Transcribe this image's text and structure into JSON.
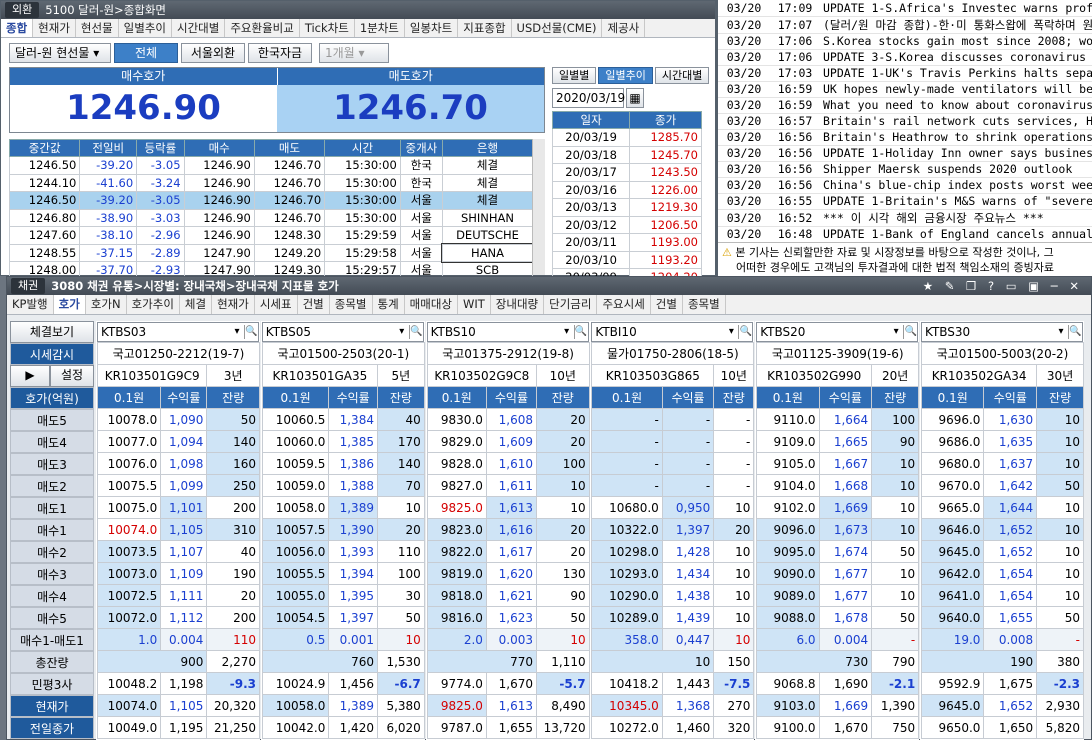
{
  "top_window": {
    "tag": "외환",
    "title": "5100 달러-원>종합화면",
    "tabs": [
      "종합",
      "현재가",
      "현선물",
      "일별추이",
      "시간대별",
      "주요환율비교",
      "Tick차트",
      "1분차트",
      "일봉차트",
      "지표종합",
      "USD선물(CME)",
      "제공사"
    ],
    "currency_select": "달러-원 현선물",
    "filters": [
      "전체",
      "서울외환",
      "한국자금"
    ],
    "period": "1개월",
    "bid_label": "매수호가",
    "ask_label": "매도호가",
    "bid": "1246.90",
    "ask": "1246.70",
    "columns": [
      "중간값",
      "전일비",
      "등락률",
      "매수",
      "매도",
      "시간",
      "중개사",
      "은행"
    ],
    "rows": [
      [
        "1246.50",
        "-39.20",
        "-3.05",
        "1246.90",
        "1246.70",
        "15:30:00",
        "한국",
        "체결"
      ],
      [
        "1244.10",
        "-41.60",
        "-3.24",
        "1246.90",
        "1246.70",
        "15:30:00",
        "한국",
        "체결"
      ],
      [
        "1246.50",
        "-39.20",
        "-3.05",
        "1246.90",
        "1246.70",
        "15:30:00",
        "서울",
        "체결"
      ],
      [
        "1246.80",
        "-38.90",
        "-3.03",
        "1246.90",
        "1246.70",
        "15:30:00",
        "서울",
        "SHINHAN"
      ],
      [
        "1247.60",
        "-38.10",
        "-2.96",
        "1246.90",
        "1248.30",
        "15:29:59",
        "서울",
        "DEUTSCHE"
      ],
      [
        "1248.55",
        "-37.15",
        "-2.89",
        "1247.90",
        "1249.20",
        "15:29:58",
        "서울",
        "HANA"
      ],
      [
        "1248.00",
        "-37.70",
        "-2.93",
        "1247.90",
        "1249.30",
        "15:29:57",
        "서울",
        "SCB"
      ]
    ],
    "daily_tabs": [
      "일별별",
      "일별추이",
      "시간대별"
    ],
    "date": "2020/03/19",
    "daily_cols": [
      "일자",
      "종가"
    ],
    "daily": [
      [
        "20/03/19",
        "1285.70"
      ],
      [
        "20/03/18",
        "1245.70"
      ],
      [
        "20/03/17",
        "1243.50"
      ],
      [
        "20/03/16",
        "1226.00"
      ],
      [
        "20/03/13",
        "1219.30"
      ],
      [
        "20/03/12",
        "1206.50"
      ],
      [
        "20/03/11",
        "1193.00"
      ],
      [
        "20/03/10",
        "1193.20"
      ],
      [
        "20/03/09",
        "1204.20"
      ]
    ]
  },
  "news": {
    "items": [
      [
        "03/20",
        "17:09",
        "UPDATE 1-S.Africa's Investec warns profits c"
      ],
      [
        "03/20",
        "17:07",
        "(달러/원 마감 종합)-한·미 통화스왑에 폭락하며 원"
      ],
      [
        "03/20",
        "17:06",
        "S.Korea stocks gain most since 2008; won su"
      ],
      [
        "03/20",
        "17:06",
        "UPDATE 3-S.Korea discusses coronavirus wi"
      ],
      [
        "03/20",
        "17:03",
        "UPDATE 1-UK's Travis Perkins halts separati"
      ],
      [
        "03/20",
        "16:59",
        "UK hopes newly-made ventilators will be rea"
      ],
      [
        "03/20",
        "16:59",
        "What you need to know about coronavirus ri"
      ],
      [
        "03/20",
        "16:57",
        "Britain's rail network cuts services, Heathrow"
      ],
      [
        "03/20",
        "16:56",
        "Britain's Heathrow to shrink operations during"
      ],
      [
        "03/20",
        "16:56",
        "UPDATE 1-Holiday Inn owner says business"
      ],
      [
        "03/20",
        "16:56",
        "Shipper Maersk suspends 2020 outlook"
      ],
      [
        "03/20",
        "16:56",
        "China's blue-chip index posts worst week in"
      ],
      [
        "03/20",
        "16:55",
        "UPDATE 1-Britain's M&S warns of \"severe imp"
      ],
      [
        "03/20",
        "16:52",
        "*** 이 시각 해외 금융시장 주요뉴스 ***"
      ],
      [
        "03/20",
        "16:48",
        "UPDATE 1-Bank of England cancels annual s"
      ]
    ],
    "disclaimer": "본 기사는 신뢰할만한 자료 및 시장정보를 바탕으로 작성한 것이나, 그",
    "disclaimer2": "어떠한 경우에도 고객님의 투자결과에 대한 법적 책임소재의 증빙자료"
  },
  "bond_window": {
    "tag": "채권",
    "title": "3080 채권 유통>시장별: 장내국채>장내국채 지표물 호가",
    "tabs": [
      "KP발행",
      "호가",
      "호가N",
      "호가추이",
      "체결",
      "현재가",
      "시세표",
      "건별",
      "종목별",
      "통계",
      "매매대상",
      "WIT",
      "장내대량",
      "단기금리",
      "주요시세",
      "건별",
      "종목별"
    ],
    "btn_fill": "체결보기",
    "btn_monitor": "시세감시",
    "btn_set": "설정",
    "hdr_label": "호가(억원)",
    "row_labels": [
      "매도5",
      "매도4",
      "매도3",
      "매도2",
      "매도1",
      "매수1",
      "매수2",
      "매수3",
      "매수4",
      "매수5",
      "매수1-매도1",
      "총잔량",
      "민평3사",
      "현재가",
      "전일종가"
    ],
    "col_headers": [
      "0.1원",
      "수익률",
      "잔량"
    ],
    "panels": [
      {
        "code": "KTBS03",
        "name": "국고01250-2212(19-7)",
        "isin": "KR103501G9C9",
        "term": "3년",
        "rows": [
          [
            "10078.0",
            "1,090",
            "50"
          ],
          [
            "10077.0",
            "1,094",
            "140"
          ],
          [
            "10076.0",
            "1,098",
            "160"
          ],
          [
            "10075.5",
            "1,099",
            "250"
          ],
          [
            "10075.0",
            "1,101",
            "200"
          ],
          [
            "10074.0",
            "1,105",
            "310"
          ],
          [
            "10073.5",
            "1,107",
            "40"
          ],
          [
            "10073.0",
            "1,109",
            "190"
          ],
          [
            "10072.5",
            "1,111",
            "20"
          ],
          [
            "10072.0",
            "1,112",
            "200"
          ],
          [
            "1.0",
            "0.004",
            "110"
          ]
        ],
        "total": [
          "900",
          "2,270"
        ],
        "min": [
          "10048.2",
          "1,198",
          "-9.3"
        ],
        "cur": [
          "10074.0",
          "1,105",
          "20,320"
        ],
        "prev": [
          "10049.0",
          "1,195",
          "21,250"
        ]
      },
      {
        "code": "KTBS05",
        "name": "국고01500-2503(20-1)",
        "isin": "KR103501GA35",
        "term": "5년",
        "rows": [
          [
            "10060.5",
            "1,384",
            "40"
          ],
          [
            "10060.0",
            "1,385",
            "170"
          ],
          [
            "10059.5",
            "1,386",
            "140"
          ],
          [
            "10059.0",
            "1,388",
            "70"
          ],
          [
            "10058.0",
            "1,389",
            "10"
          ],
          [
            "10057.5",
            "1,390",
            "20"
          ],
          [
            "10056.0",
            "1,393",
            "110"
          ],
          [
            "10055.5",
            "1,394",
            "100"
          ],
          [
            "10055.0",
            "1,395",
            "30"
          ],
          [
            "10054.5",
            "1,397",
            "50"
          ],
          [
            "0.5",
            "0.001",
            "10"
          ]
        ],
        "total": [
          "760",
          "1,530"
        ],
        "min": [
          "10024.9",
          "1,456",
          "-6.7"
        ],
        "cur": [
          "10058.0",
          "1,389",
          "5,380"
        ],
        "prev": [
          "10042.0",
          "1,420",
          "6,020"
        ]
      },
      {
        "code": "KTBS10",
        "name": "국고01375-2912(19-8)",
        "isin": "KR103502G9C8",
        "term": "10년",
        "rows": [
          [
            "9830.0",
            "1,608",
            "20"
          ],
          [
            "9829.0",
            "1,609",
            "20"
          ],
          [
            "9828.0",
            "1,610",
            "100"
          ],
          [
            "9827.0",
            "1,611",
            "10"
          ],
          [
            "9825.0",
            "1,613",
            "10"
          ],
          [
            "9823.0",
            "1,616",
            "20"
          ],
          [
            "9822.0",
            "1,617",
            "20"
          ],
          [
            "9819.0",
            "1,620",
            "130"
          ],
          [
            "9818.0",
            "1,621",
            "90"
          ],
          [
            "9816.0",
            "1,623",
            "50"
          ],
          [
            "2.0",
            "0.003",
            "10"
          ]
        ],
        "total": [
          "770",
          "1,110"
        ],
        "min": [
          "9774.0",
          "1,670",
          "-5.7"
        ],
        "cur": [
          "9825.0",
          "1,613",
          "8,490"
        ],
        "prev": [
          "9787.0",
          "1,655",
          "13,720"
        ]
      },
      {
        "code": "KTBI10",
        "name": "물가01750-2806(18-5)",
        "isin": "KR103503G865",
        "term": "10년",
        "rows": [
          [
            "-",
            "-",
            "-"
          ],
          [
            "-",
            "-",
            "-"
          ],
          [
            "-",
            "-",
            "-"
          ],
          [
            "-",
            "-",
            "-"
          ],
          [
            "10680.0",
            "0,950",
            "10"
          ],
          [
            "10322.0",
            "1,397",
            "20"
          ],
          [
            "10298.0",
            "1,428",
            "10"
          ],
          [
            "10293.0",
            "1,434",
            "10"
          ],
          [
            "10290.0",
            "1,438",
            "10"
          ],
          [
            "10289.0",
            "1,439",
            "10"
          ],
          [
            "358.0",
            "0,447",
            "10"
          ]
        ],
        "total": [
          "10",
          "150"
        ],
        "min": [
          "10418.2",
          "1,443",
          "-7.5"
        ],
        "cur": [
          "10345.0",
          "1,368",
          "270"
        ],
        "prev": [
          "10272.0",
          "1,460",
          "320"
        ]
      },
      {
        "code": "KTBS20",
        "name": "국고01125-3909(19-6)",
        "isin": "KR103502G990",
        "term": "20년",
        "rows": [
          [
            "9110.0",
            "1,664",
            "100"
          ],
          [
            "9109.0",
            "1,665",
            "90"
          ],
          [
            "9105.0",
            "1,667",
            "10"
          ],
          [
            "9104.0",
            "1,668",
            "10"
          ],
          [
            "9102.0",
            "1,669",
            "10"
          ],
          [
            "9096.0",
            "1,673",
            "10"
          ],
          [
            "9095.0",
            "1,674",
            "50"
          ],
          [
            "9090.0",
            "1,677",
            "10"
          ],
          [
            "9089.0",
            "1,677",
            "10"
          ],
          [
            "9088.0",
            "1,678",
            "50"
          ],
          [
            "6.0",
            "0.004",
            "-"
          ]
        ],
        "total": [
          "730",
          "790"
        ],
        "min": [
          "9068.8",
          "1,690",
          "-2.1"
        ],
        "cur": [
          "9103.0",
          "1,669",
          "1,390"
        ],
        "prev": [
          "9100.0",
          "1,670",
          "750"
        ]
      },
      {
        "code": "KTBS30",
        "name": "국고01500-5003(20-2)",
        "isin": "KR103502GA34",
        "term": "30년",
        "rows": [
          [
            "9696.0",
            "1,630",
            "10"
          ],
          [
            "9686.0",
            "1,635",
            "10"
          ],
          [
            "9680.0",
            "1,637",
            "10"
          ],
          [
            "9670.0",
            "1,642",
            "50"
          ],
          [
            "9665.0",
            "1,644",
            "10"
          ],
          [
            "9646.0",
            "1,652",
            "10"
          ],
          [
            "9645.0",
            "1,652",
            "10"
          ],
          [
            "9642.0",
            "1,654",
            "10"
          ],
          [
            "9641.0",
            "1,654",
            "10"
          ],
          [
            "9640.0",
            "1,655",
            "50"
          ],
          [
            "19.0",
            "0.008",
            "-"
          ]
        ],
        "total": [
          "190",
          "380"
        ],
        "min": [
          "9592.9",
          "1,675",
          "-2.3"
        ],
        "cur": [
          "9645.0",
          "1,652",
          "2,930"
        ],
        "prev": [
          "9650.0",
          "1,650",
          "5,820"
        ]
      }
    ]
  }
}
